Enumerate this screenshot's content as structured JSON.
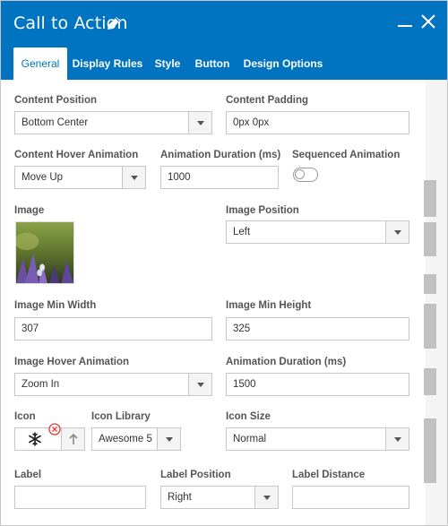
{
  "dialog": {
    "title": "Call to Action"
  },
  "tabs": [
    {
      "label": "General"
    },
    {
      "label": "Display Rules"
    },
    {
      "label": "Style"
    },
    {
      "label": "Button"
    },
    {
      "label": "Design Options"
    }
  ],
  "form": {
    "content_position": {
      "label": "Content Position",
      "value": "Bottom Center"
    },
    "content_padding": {
      "label": "Content Padding",
      "value": "0px 0px"
    },
    "content_hover_animation": {
      "label": "Content Hover Animation",
      "value": "Move Up"
    },
    "animation_duration_1": {
      "label": "Animation Duration (ms)",
      "value": "1000"
    },
    "sequenced_animation": {
      "label": "Sequenced Animation",
      "on": false
    },
    "image": {
      "label": "Image"
    },
    "image_position": {
      "label": "Image Position",
      "value": "Left"
    },
    "image_min_width": {
      "label": "Image Min Width",
      "value": "307"
    },
    "image_min_height": {
      "label": "Image Min Height",
      "value": "325"
    },
    "image_hover_animation": {
      "label": "Image Hover Animation",
      "value": "Zoom In"
    },
    "animation_duration_2": {
      "label": "Animation Duration (ms)",
      "value": "1500"
    },
    "icon": {
      "label": "Icon",
      "icon_name": "snowflake-icon"
    },
    "icon_library": {
      "label": "Icon Library",
      "value": "Awesome 5"
    },
    "icon_size": {
      "label": "Icon Size",
      "value": "Normal"
    },
    "label": {
      "label": "Label",
      "value": ""
    },
    "label_position": {
      "label": "Label Position",
      "value": "Right"
    },
    "label_distance": {
      "label": "Label Distance",
      "value": ""
    }
  },
  "colors": {
    "header": "#0074c0",
    "remove": "#e53935"
  }
}
